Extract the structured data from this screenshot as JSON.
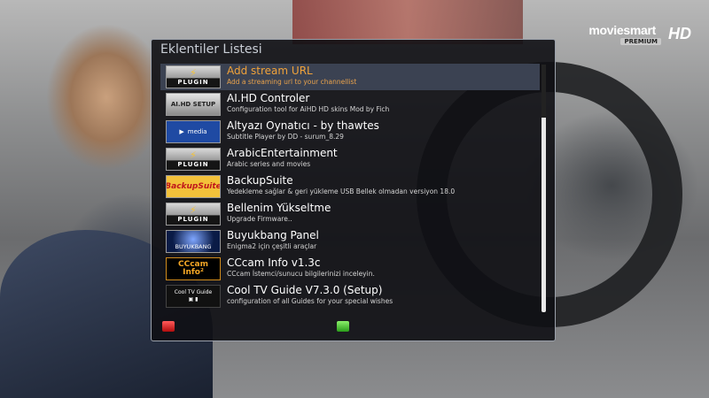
{
  "logo": {
    "name": "moviesmart",
    "premium": "PREMIUM",
    "hd": "HD"
  },
  "window": {
    "title": "Eklentiler Listesi"
  },
  "items": [
    {
      "title": "Add stream URL",
      "desc": "Add a streaming url to your channellist",
      "thumb": "plugin",
      "thumb_label": "PLUGIN",
      "selected": true
    },
    {
      "title": "AI.HD Controler",
      "desc": "Configuration tool for AiHD HD skins  Mod by Fich",
      "thumb": "aihd",
      "thumb_label": "AI.HD SETUP"
    },
    {
      "title": "Altyazı Oynatıcı - by thawtes",
      "desc": "Subtitle Player by DD - surum_8.29",
      "thumb": "alty",
      "thumb_label": "media"
    },
    {
      "title": "ArabicEntertainment",
      "desc": "Arabic series and movies",
      "thumb": "plugin",
      "thumb_label": "PLUGIN"
    },
    {
      "title": "BackupSuite",
      "desc": "Yedekleme sağlar & geri yükleme USB Bellek olmadan versiyon 18.0",
      "thumb": "backup",
      "thumb_label": "BackupSuite"
    },
    {
      "title": "Bellenim Yükseltme",
      "desc": "Upgrade Firmware..",
      "thumb": "plugin",
      "thumb_label": "PLUGIN"
    },
    {
      "title": "Buyukbang Panel",
      "desc": "Enigma2 için çeşitli araçlar",
      "thumb": "buyuk",
      "thumb_label": "BUYUKBANG"
    },
    {
      "title": "CCcam Info v1.3c",
      "desc": "CCcam İstemci/sunucu bilgilerinizi inceleyin.",
      "thumb": "cccam",
      "thumb_label": "CCcam",
      "thumb_label2": "Info²"
    },
    {
      "title": "Cool TV Guide V7.3.0 (Setup)",
      "desc": "configuration of all Guides for your special wishes",
      "thumb": "cool",
      "thumb_label": "Cool TV Guide"
    }
  ],
  "buttons": {
    "red": "red-button",
    "green": "green-button"
  },
  "colors": {
    "selected_text": "#f0a23a",
    "selected_bg": "#3b4252",
    "window_bg": "#101014"
  }
}
